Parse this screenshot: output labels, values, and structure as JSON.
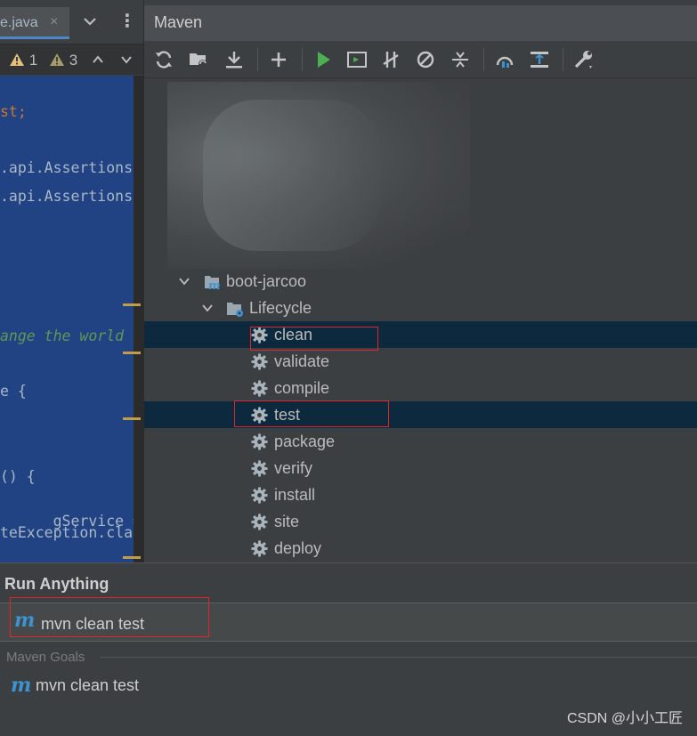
{
  "editor": {
    "tab_name": "e.java",
    "tab_close": "×",
    "more": "⋮",
    "warnings": [
      {
        "count": "1",
        "color": "#e5c07b"
      },
      {
        "count": "3",
        "color": "#a89b6b"
      }
    ],
    "code_lines": [
      "st;",
      ".api.Assertions",
      ".api.Assertions",
      "ange the world",
      "e {",
      "() {",
      "gService = new",
      "teException.cla"
    ]
  },
  "maven": {
    "title": "Maven",
    "tree": {
      "project": "boot-jarcoo",
      "lifecycle": "Lifecycle",
      "phases": [
        "clean",
        "validate",
        "compile",
        "test",
        "package",
        "verify",
        "install",
        "site",
        "deploy"
      ],
      "selected": [
        "clean",
        "test"
      ]
    }
  },
  "run_anything": {
    "title": "Run Anything",
    "input_value": "mvn clean test",
    "section": "Maven Goals",
    "result": "mvn clean test"
  },
  "watermark": "CSDN @小小工匠",
  "colors": {
    "accent_blue": "#3d93d1",
    "selection": "#0d293e",
    "highlight_red": "#e0262b",
    "run_green": "#4caf50"
  }
}
